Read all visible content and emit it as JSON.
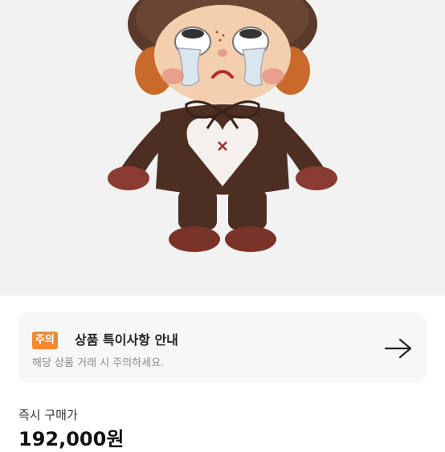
{
  "product": {
    "image_alt": "figure-doll-in-brown-bear-costume"
  },
  "notice": {
    "badge": "주의",
    "title": "상품 특이사항 안내",
    "description": "해당 상품 거래 시 주의하세요.",
    "arrow_icon": "arrow-right-icon"
  },
  "pricing": {
    "label": "즉시 구매가",
    "price": "192,000원"
  },
  "colors": {
    "image_bg": "#f2f2f2",
    "badge": "#f08a35",
    "card_bg": "#f7f7f7"
  }
}
